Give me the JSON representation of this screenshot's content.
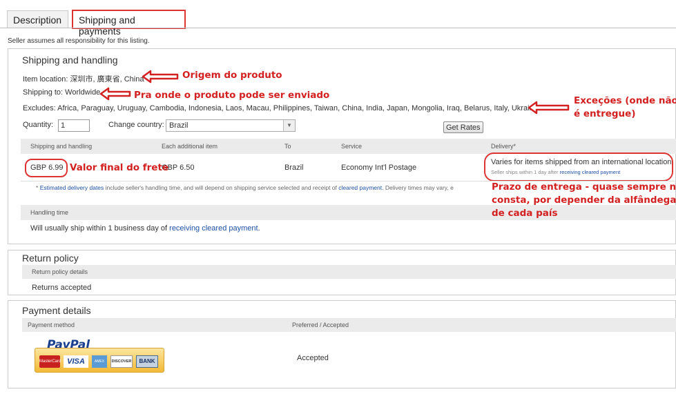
{
  "tabs": [
    {
      "label": "Description"
    },
    {
      "label": "Shipping and payments"
    }
  ],
  "notice": "Seller assumes all responsibility for this listing.",
  "shipping": {
    "title": "Shipping and handling",
    "item_location": "Item location: 深圳市, 廣東省, China",
    "shipping_to": "Shipping to: Worldwide",
    "excludes": "Excludes: Africa, Paraguay, Uruguay, Cambodia, Indonesia, Laos, Macau, Philippines, Taiwan, China, India, Japan, Mongolia, Iraq, Belarus, Italy, Ukraine",
    "quantity_label": "Quantity:",
    "quantity_value": "1",
    "country_label": "Change country:",
    "country_value": "Brazil",
    "get_rates": "Get Rates",
    "table_headers": [
      "Shipping and handling",
      "Each additional item",
      "To",
      "Service",
      "Delivery*"
    ],
    "row": {
      "cost": "GBP 6.99",
      "additional": "GBP 6.50",
      "to": "Brazil",
      "service": "Economy Int'l Postage",
      "delivery": "Varies for items shipped from an international location",
      "delivery_note_prefix": "Seller ships within 1 day after",
      "delivery_note_link": "receiving cleared payment"
    },
    "footnote_star": "*",
    "footnote_link1": "Estimated delivery dates",
    "footnote_mid": "include seller's handling time, and will depend on shipping service selected and receipt of",
    "footnote_link2": "cleared payment",
    "footnote_end": ". Delivery times may vary, e",
    "handling_header": "Handling time",
    "handling_text": "Will usually ship within 1 business day of",
    "handling_link": "receiving cleared payment",
    "handling_end": "."
  },
  "return_policy": {
    "title": "Return policy",
    "header": "Return policy details",
    "text": "Returns accepted"
  },
  "payment": {
    "title": "Payment details",
    "header_method": "Payment method",
    "header_pref": "Preferred / Accepted",
    "paypal_logo": "PayPal",
    "cards": [
      "MasterCard",
      "VISA",
      "AMEX",
      "DISCOVER",
      "BANK"
    ],
    "status": "Accepted"
  },
  "annotations": {
    "origem": "Origem do produto",
    "pra_onde": "Pra onde o produto pode ser enviado",
    "excecoes_1": "Exceções (onde não",
    "excecoes_2": "é entregue)",
    "valor": "Valor final do frete",
    "prazo_1": "Prazo de entrega - quase sempre não",
    "prazo_2": "consta, por depender da alfândega",
    "prazo_3": "de cada país"
  },
  "colors": {
    "annotation_red": "#d32020",
    "link_blue": "#1d4fa3",
    "paypal_blue": "#1a3f8f"
  }
}
